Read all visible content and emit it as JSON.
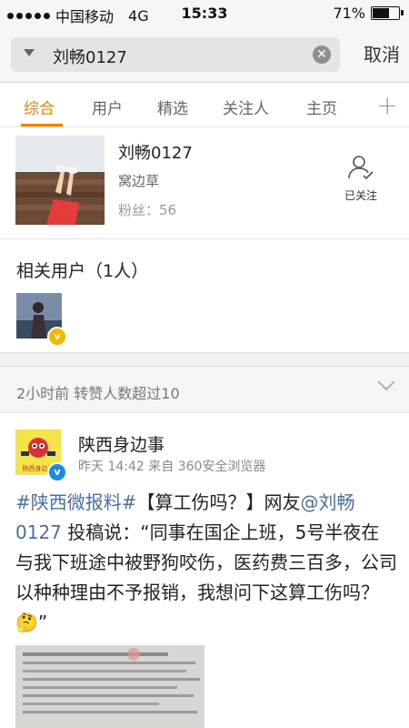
{
  "status_bar": {
    "carrier": "中国移动",
    "network": "4G",
    "time": "15:33",
    "battery_text": "71%",
    "battery_level": 0.71
  },
  "search": {
    "query": "刘畅0127",
    "cancel_label": "取消"
  },
  "tabs": [
    {
      "label": "综合",
      "active": true
    },
    {
      "label": "用户",
      "active": false
    },
    {
      "label": "精选",
      "active": false
    },
    {
      "label": "关注人",
      "active": false
    },
    {
      "label": "主页",
      "active": false
    }
  ],
  "tab_add_symbol": "+",
  "user_card": {
    "name": "刘畅0127",
    "bio": "窝边草",
    "fans": "粉丝：56",
    "follow_label": "已关注"
  },
  "related_users": {
    "title": "相关用户（1人）",
    "verified_mark": "v"
  },
  "feed": {
    "header": "2小时前 转赞人数超过10"
  },
  "post": {
    "author": "陕西身边事",
    "meta": "昨天 14:42  来自 360安全浏览器",
    "hashtag": "#陕西微报料#",
    "text_1": "【算工伤吗？】网友",
    "mention": "@刘畅0127",
    "text_2": " 投稿说：“同事在国企上班，5号半夜在与我下班途中被野狗咬伤，医药费三百多，公司以种种理由不予报销，我想问下这算工伤吗？",
    "emoji": "🤔",
    "text_3": "”",
    "avatar_caption": "陕西身边事",
    "verified_mark": "v"
  },
  "colors": {
    "accent": "#f08200",
    "link": "#4a6fa5",
    "verified": "#f7b500"
  }
}
